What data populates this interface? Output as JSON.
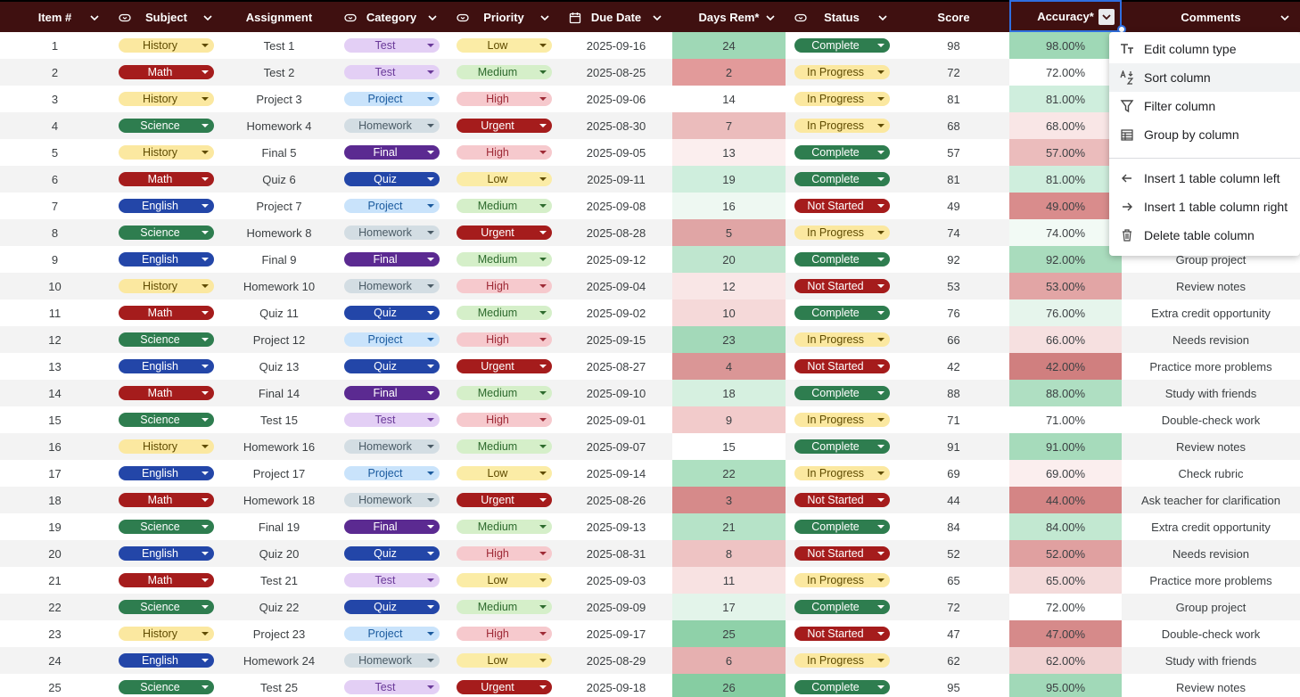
{
  "columns": [
    {
      "key": "item",
      "label": "Item #"
    },
    {
      "key": "subject",
      "label": "Subject"
    },
    {
      "key": "assignment",
      "label": "Assignment"
    },
    {
      "key": "category",
      "label": "Category"
    },
    {
      "key": "priority",
      "label": "Priority"
    },
    {
      "key": "due",
      "label": "Due Date"
    },
    {
      "key": "days",
      "label": "Days Rem*"
    },
    {
      "key": "status",
      "label": "Status"
    },
    {
      "key": "score",
      "label": "Score"
    },
    {
      "key": "accuracy",
      "label": "Accuracy*"
    },
    {
      "key": "comments",
      "label": "Comments"
    }
  ],
  "chip_styles": {
    "subject": {
      "History": {
        "bg": "#fbe8a0",
        "fg": "#5f4b00"
      },
      "Math": {
        "bg": "#a51c1c",
        "fg": "#ffffff"
      },
      "Science": {
        "bg": "#2e7d4f",
        "fg": "#ffffff"
      },
      "English": {
        "bg": "#2346a8",
        "fg": "#ffffff"
      }
    },
    "category": {
      "Test": {
        "bg": "#e3cff5",
        "fg": "#6a3a99"
      },
      "Project": {
        "bg": "#c9e3fb",
        "fg": "#1a5a9e"
      },
      "Homework": {
        "bg": "#d3dde3",
        "fg": "#4a5b66"
      },
      "Final": {
        "bg": "#5b2a91",
        "fg": "#ffffff"
      },
      "Quiz": {
        "bg": "#2346a8",
        "fg": "#ffffff"
      }
    },
    "priority": {
      "Low": {
        "bg": "#fbeca6",
        "fg": "#5f4b00"
      },
      "Medium": {
        "bg": "#d5efc9",
        "fg": "#2e6b2e"
      },
      "High": {
        "bg": "#f6c9cd",
        "fg": "#9e2a36"
      },
      "Urgent": {
        "bg": "#a51c1c",
        "fg": "#ffffff"
      }
    },
    "status": {
      "Complete": {
        "bg": "#2e7d4f",
        "fg": "#ffffff"
      },
      "In Progress": {
        "bg": "#fbe8a0",
        "fg": "#5f4b00"
      },
      "Not Started": {
        "bg": "#a51c1c",
        "fg": "#ffffff"
      }
    }
  },
  "rows": [
    {
      "item": "1",
      "subject": "History",
      "assignment": "Test 1",
      "category": "Test",
      "priority": "Low",
      "due": "2025-09-16",
      "days": "24",
      "status": "Complete",
      "score": "98",
      "accuracy": "98.00%",
      "comments": "",
      "days_fill": "#9fd8b6",
      "acc_fill": "#9fd8b6"
    },
    {
      "item": "2",
      "subject": "Math",
      "assignment": "Test 2",
      "category": "Test",
      "priority": "Medium",
      "due": "2025-08-25",
      "days": "2",
      "status": "In Progress",
      "score": "72",
      "accuracy": "72.00%",
      "comments": "",
      "days_fill": "#e29a9a",
      "acc_fill": "#ffffff"
    },
    {
      "item": "3",
      "subject": "History",
      "assignment": "Project 3",
      "category": "Project",
      "priority": "High",
      "due": "2025-09-06",
      "days": "14",
      "status": "In Progress",
      "score": "81",
      "accuracy": "81.00%",
      "comments": "",
      "days_fill": "#ffffff",
      "acc_fill": "#cfeedd"
    },
    {
      "item": "4",
      "subject": "Science",
      "assignment": "Homework 4",
      "category": "Homework",
      "priority": "Urgent",
      "due": "2025-08-30",
      "days": "7",
      "status": "In Progress",
      "score": "68",
      "accuracy": "68.00%",
      "comments": "",
      "days_fill": "#ebbcbc",
      "acc_fill": "#f9e6e6"
    },
    {
      "item": "5",
      "subject": "History",
      "assignment": "Final 5",
      "category": "Final",
      "priority": "High",
      "due": "2025-09-05",
      "days": "13",
      "status": "Complete",
      "score": "57",
      "accuracy": "57.00%",
      "comments": "",
      "days_fill": "#fbeeee",
      "acc_fill": "#ebbcbc"
    },
    {
      "item": "6",
      "subject": "Math",
      "assignment": "Quiz 6",
      "category": "Quiz",
      "priority": "Low",
      "due": "2025-09-11",
      "days": "19",
      "status": "Complete",
      "score": "81",
      "accuracy": "81.00%",
      "comments": "",
      "days_fill": "#cfeedd",
      "acc_fill": "#cfeedd"
    },
    {
      "item": "7",
      "subject": "English",
      "assignment": "Project 7",
      "category": "Project",
      "priority": "Medium",
      "due": "2025-09-08",
      "days": "16",
      "status": "Not Started",
      "score": "49",
      "accuracy": "49.00%",
      "comments": "",
      "days_fill": "#eef8f2",
      "acc_fill": "#d98c8c"
    },
    {
      "item": "8",
      "subject": "Science",
      "assignment": "Homework 8",
      "category": "Homework",
      "priority": "Urgent",
      "due": "2025-08-28",
      "days": "5",
      "status": "In Progress",
      "score": "74",
      "accuracy": "74.00%",
      "comments": "",
      "days_fill": "#e0a5a5",
      "acc_fill": "#f2faf5"
    },
    {
      "item": "9",
      "subject": "English",
      "assignment": "Final 9",
      "category": "Final",
      "priority": "Medium",
      "due": "2025-09-12",
      "days": "20",
      "status": "Complete",
      "score": "92",
      "accuracy": "92.00%",
      "comments": "Group project",
      "days_fill": "#bfe6cf",
      "acc_fill": "#a9dcbd"
    },
    {
      "item": "10",
      "subject": "History",
      "assignment": "Homework 10",
      "category": "Homework",
      "priority": "High",
      "due": "2025-09-04",
      "days": "12",
      "status": "Not Started",
      "score": "53",
      "accuracy": "53.00%",
      "comments": "Review notes",
      "days_fill": "#f9e6e6",
      "acc_fill": "#e2a5a5"
    },
    {
      "item": "11",
      "subject": "Math",
      "assignment": "Quiz 11",
      "category": "Quiz",
      "priority": "Medium",
      "due": "2025-09-02",
      "days": "10",
      "status": "Complete",
      "score": "76",
      "accuracy": "76.00%",
      "comments": "Extra credit opportunity",
      "days_fill": "#f5d9d9",
      "acc_fill": "#e6f5ec"
    },
    {
      "item": "12",
      "subject": "Science",
      "assignment": "Project 12",
      "category": "Project",
      "priority": "High",
      "due": "2025-09-15",
      "days": "23",
      "status": "In Progress",
      "score": "66",
      "accuracy": "66.00%",
      "comments": "Needs revision",
      "days_fill": "#a3d9b9",
      "acc_fill": "#f6e0e0"
    },
    {
      "item": "13",
      "subject": "English",
      "assignment": "Quiz 13",
      "category": "Quiz",
      "priority": "Urgent",
      "due": "2025-08-27",
      "days": "4",
      "status": "Not Started",
      "score": "42",
      "accuracy": "42.00%",
      "comments": "Practice more problems",
      "days_fill": "#da9696",
      "acc_fill": "#d07f7f"
    },
    {
      "item": "14",
      "subject": "Math",
      "assignment": "Final 14",
      "category": "Final",
      "priority": "Medium",
      "due": "2025-09-10",
      "days": "18",
      "status": "Complete",
      "score": "88",
      "accuracy": "88.00%",
      "comments": "Study with friends",
      "days_fill": "#d6f0e0",
      "acc_fill": "#afdfc2"
    },
    {
      "item": "15",
      "subject": "Science",
      "assignment": "Test 15",
      "category": "Test",
      "priority": "High",
      "due": "2025-09-01",
      "days": "9",
      "status": "In Progress",
      "score": "71",
      "accuracy": "71.00%",
      "comments": "Double-check work",
      "days_fill": "#f2cbcb",
      "acc_fill": "#ffffff"
    },
    {
      "item": "16",
      "subject": "History",
      "assignment": "Homework 16",
      "category": "Homework",
      "priority": "Medium",
      "due": "2025-09-07",
      "days": "15",
      "status": "Complete",
      "score": "91",
      "accuracy": "91.00%",
      "comments": "Review notes",
      "days_fill": "#ffffff",
      "acc_fill": "#a6dbbb"
    },
    {
      "item": "17",
      "subject": "English",
      "assignment": "Project 17",
      "category": "Project",
      "priority": "Low",
      "due": "2025-09-14",
      "days": "22",
      "status": "In Progress",
      "score": "69",
      "accuracy": "69.00%",
      "comments": "Check rubric",
      "days_fill": "#aee0c1",
      "acc_fill": "#fbeeee"
    },
    {
      "item": "18",
      "subject": "Math",
      "assignment": "Homework 18",
      "category": "Homework",
      "priority": "Urgent",
      "due": "2025-08-26",
      "days": "3",
      "status": "Not Started",
      "score": "44",
      "accuracy": "44.00%",
      "comments": "Ask teacher for clarification",
      "days_fill": "#d68a8a",
      "acc_fill": "#d48585"
    },
    {
      "item": "19",
      "subject": "Science",
      "assignment": "Final 19",
      "category": "Final",
      "priority": "Medium",
      "due": "2025-09-13",
      "days": "21",
      "status": "Complete",
      "score": "84",
      "accuracy": "84.00%",
      "comments": "Extra credit opportunity",
      "days_fill": "#b6e3c8",
      "acc_fill": "#c2e8d1"
    },
    {
      "item": "20",
      "subject": "English",
      "assignment": "Quiz 20",
      "category": "Quiz",
      "priority": "High",
      "due": "2025-08-31",
      "days": "8",
      "status": "Not Started",
      "score": "52",
      "accuracy": "52.00%",
      "comments": "Needs revision",
      "days_fill": "#eec3c3",
      "acc_fill": "#e0a0a0"
    },
    {
      "item": "21",
      "subject": "Math",
      "assignment": "Test 21",
      "category": "Test",
      "priority": "Low",
      "due": "2025-09-03",
      "days": "11",
      "status": "In Progress",
      "score": "65",
      "accuracy": "65.00%",
      "comments": "Practice more problems",
      "days_fill": "#f8e2e2",
      "acc_fill": "#f4dada"
    },
    {
      "item": "22",
      "subject": "Science",
      "assignment": "Quiz 22",
      "category": "Quiz",
      "priority": "Medium",
      "due": "2025-09-09",
      "days": "17",
      "status": "Complete",
      "score": "72",
      "accuracy": "72.00%",
      "comments": "Group project",
      "days_fill": "#e3f4ea",
      "acc_fill": "#ffffff"
    },
    {
      "item": "23",
      "subject": "History",
      "assignment": "Project 23",
      "category": "Project",
      "priority": "High",
      "due": "2025-09-17",
      "days": "25",
      "status": "Not Started",
      "score": "47",
      "accuracy": "47.00%",
      "comments": "Double-check work",
      "days_fill": "#8fd1a9",
      "acc_fill": "#d68a8a"
    },
    {
      "item": "24",
      "subject": "English",
      "assignment": "Homework 24",
      "category": "Homework",
      "priority": "Low",
      "due": "2025-08-29",
      "days": "6",
      "status": "In Progress",
      "score": "62",
      "accuracy": "62.00%",
      "comments": "Study with friends",
      "days_fill": "#e6b0b0",
      "acc_fill": "#f1d2d2"
    },
    {
      "item": "25",
      "subject": "Science",
      "assignment": "Test 25",
      "category": "Test",
      "priority": "Urgent",
      "due": "2025-09-18",
      "days": "26",
      "status": "Complete",
      "score": "95",
      "accuracy": "95.00%",
      "comments": "Review notes",
      "days_fill": "#86cda2",
      "acc_fill": "#a1d9b8"
    }
  ],
  "context_menu": {
    "items": [
      {
        "label": "Edit column type",
        "icon": "text-type-icon"
      },
      {
        "label": "Sort column",
        "icon": "sort-az-icon"
      },
      {
        "label": "Filter column",
        "icon": "filter-icon"
      },
      {
        "label": "Group by column",
        "icon": "group-table-icon"
      },
      {
        "label": "Insert 1 table column left",
        "icon": "arrow-left-icon"
      },
      {
        "label": "Insert 1 table column right",
        "icon": "arrow-right-icon"
      },
      {
        "label": "Delete table column",
        "icon": "trash-icon"
      }
    ]
  }
}
